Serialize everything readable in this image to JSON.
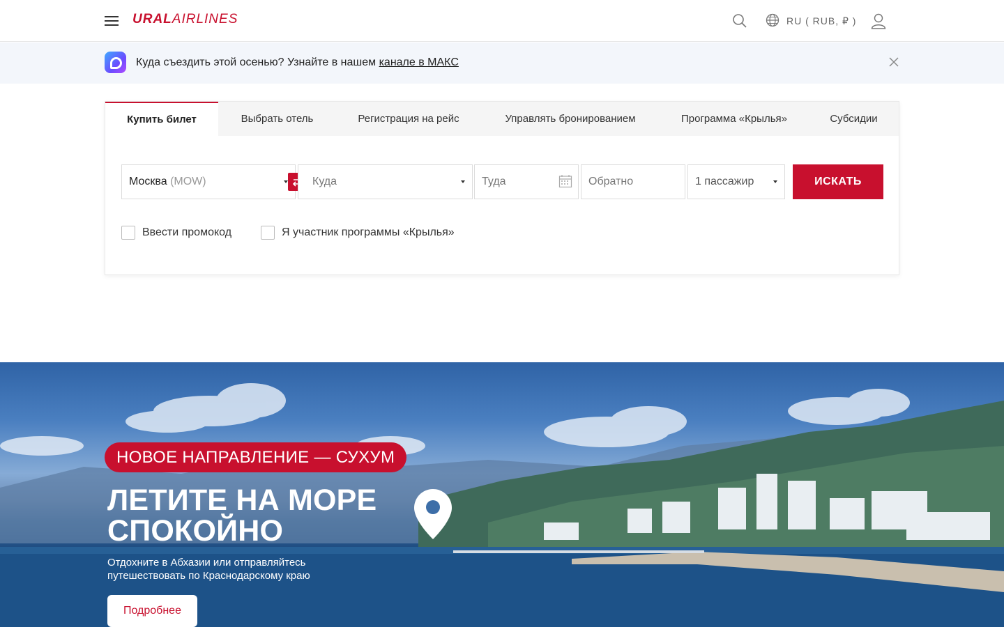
{
  "header": {
    "logo_bold": "URAL",
    "logo_light": "AIRLINES",
    "language": "RU ( RUB, ₽ )"
  },
  "notice": {
    "text": "Куда съездить этой осенью? Узнайте в нашем ",
    "link": "канале в МАКС"
  },
  "booking": {
    "tabs": [
      {
        "label": "Купить билет",
        "active": true
      },
      {
        "label": "Выбрать отель"
      },
      {
        "label": "Регистрация на рейс"
      },
      {
        "label": "Управлять бронированием"
      },
      {
        "label": "Программа «Крылья»"
      },
      {
        "label": "Субсидии"
      }
    ],
    "from_city": "Москва",
    "from_code": "(MOW)",
    "to_placeholder": "Куда",
    "depart_placeholder": "Туда",
    "return_placeholder": "Обратно",
    "passengers": "1 пассажир",
    "search_label": "ИСКАТЬ",
    "promo_label": "Ввести промокод",
    "loyalty_label": "Я участник программы «Крылья»"
  },
  "hero": {
    "badge": "НОВОЕ НАПРАВЛЕНИЕ — СУХУМ",
    "title_line1": "ЛЕТИТЕ НА МОРЕ",
    "title_line2": "СПОКОЙНО",
    "subtitle_line1": "Отдохните в Абхазии или отправляйтесь",
    "subtitle_line2": "путешествовать по Краснодарскому краю",
    "button": "Подробнее"
  },
  "colors": {
    "brand": "#c8102e",
    "notice_bg": "#f3f6fb"
  }
}
